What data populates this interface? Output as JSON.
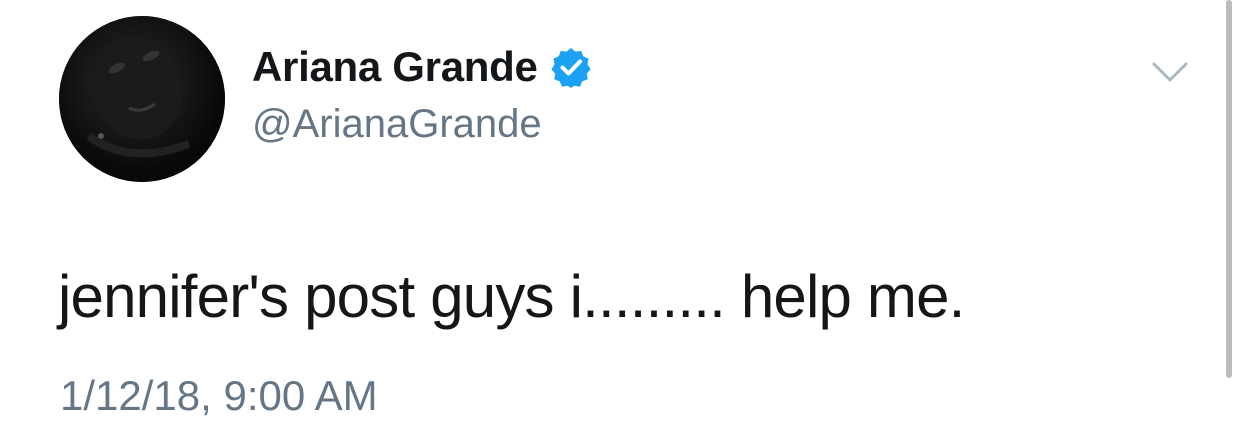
{
  "tweet": {
    "author": {
      "display_name": "Ariana Grande",
      "handle": "@ArianaGrande",
      "verified": true,
      "avatar_icon": "profile-photo"
    },
    "text": "jennifer's post guys i......... help me.",
    "timestamp": "1/12/18, 9:00 AM",
    "menu_icon": "chevron-down-icon"
  },
  "colors": {
    "text_primary": "#14171a",
    "text_secondary": "#657786",
    "verified_blue": "#1da1f2",
    "caret_gray": "#aab8c2",
    "background": "#ffffff"
  }
}
